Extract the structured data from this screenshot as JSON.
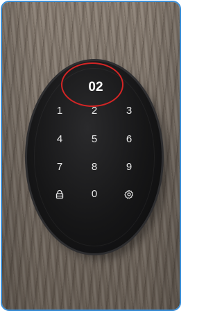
{
  "display": {
    "code": "02"
  },
  "keypad": {
    "keys": [
      "1",
      "2",
      "3",
      "4",
      "5",
      "6",
      "7",
      "8",
      "9",
      "0"
    ],
    "lock_icon": "padlock-icon",
    "settings_icon": "gear-icon"
  },
  "colors": {
    "frame_border": "#3d8fd6",
    "highlight_ring": "#d42525",
    "lock_body": "#161617",
    "key_text": "#e9e9e9"
  }
}
